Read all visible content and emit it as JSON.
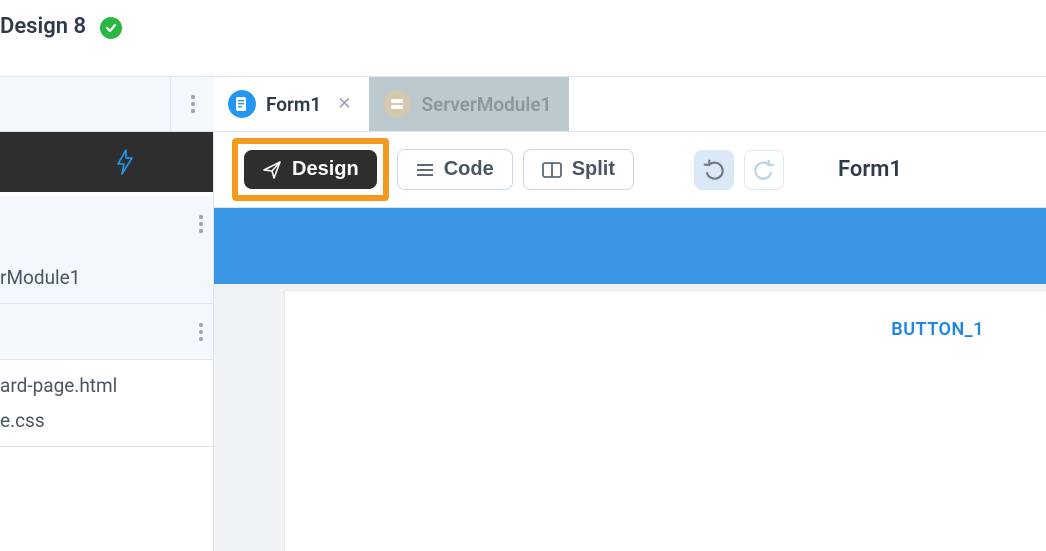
{
  "header": {
    "title": "Design 8"
  },
  "tabs": {
    "active": {
      "label": "Form1"
    },
    "inactive": {
      "label": "ServerModule1"
    }
  },
  "sidebar": {
    "module_item": "rModule1",
    "files": [
      "ard-page.html",
      "e.css"
    ]
  },
  "toolbar": {
    "design": "Design",
    "code": "Code",
    "split": "Split",
    "form_name": "Form1"
  },
  "canvas": {
    "button_label": "BUTTON_1"
  }
}
